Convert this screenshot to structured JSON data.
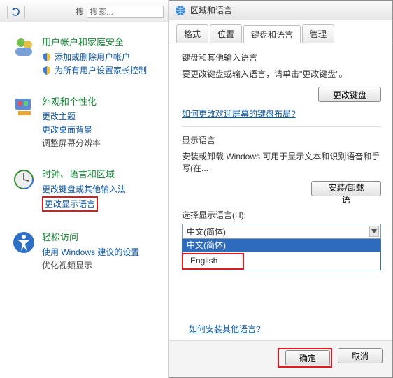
{
  "toolbar": {
    "search_placeholder": "搜索...",
    "search_label": "搜"
  },
  "left": {
    "accounts": {
      "heading": "用户帐户和家庭安全",
      "sub1": "添加或删除用户帐户",
      "sub2": "为所有用户设置家长控制"
    },
    "appearance": {
      "heading": "外观和个性化",
      "sub1": "更改主题",
      "sub2": "更改桌面背景",
      "sub3": "调整屏幕分辨率"
    },
    "clock": {
      "heading": "时钟、语言和区域",
      "sub1": "更改键盘或其他输入法",
      "sub2": "更改显示语言"
    },
    "ease": {
      "heading": "轻松访问",
      "sub1": "使用 Windows 建议的设置",
      "sub2": "优化视频显示"
    }
  },
  "dialog": {
    "title": "区域和语言",
    "tabs": {
      "format": "格式",
      "location": "位置",
      "keyboard": "键盘和语言",
      "admin": "管理"
    },
    "group1_label": "键盘和其他输入语言",
    "group1_text": "要更改键盘或输入语言，请单击\"更改键盘\"。",
    "change_keyboard_btn": "更改键盘",
    "welcome_link": "如何更改欢迎屏幕的键盘布局?",
    "display_label": "显示语言",
    "display_text": "安装或卸载 Windows 可用于显示文本和识别语音和手写(在...",
    "install_btn": "安装/卸载语",
    "select_lang_label": "选择显示语言(H):",
    "current": "中文(简体)",
    "option_zh": "中文(简体)",
    "option_en": "English",
    "other_lang_link": "如何安装其他语言?",
    "ok": "确定",
    "cancel": "取消"
  }
}
